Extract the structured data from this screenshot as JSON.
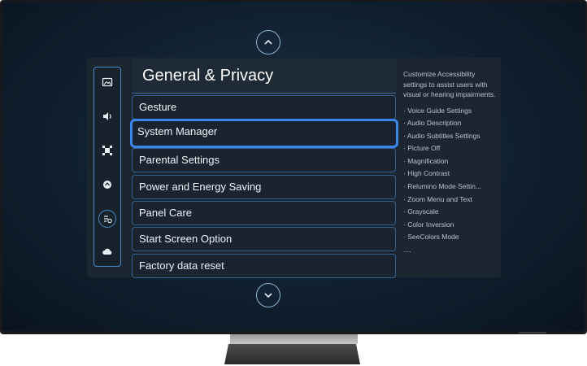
{
  "menu": {
    "title": "General & Privacy",
    "items": [
      {
        "label": "Gesture"
      },
      {
        "label": "System Manager"
      },
      {
        "label": "Parental Settings"
      },
      {
        "label": "Power and Energy Saving"
      },
      {
        "label": "Panel Care"
      },
      {
        "label": "Start Screen Option"
      },
      {
        "label": "Factory data reset"
      }
    ],
    "focused_item": "System Manager"
  },
  "sidebar": {
    "icons": [
      "picture-icon",
      "sound-icon",
      "connection-icon",
      "support-icon",
      "general-privacy-icon",
      "cloud-icon"
    ],
    "active": "general-privacy-icon"
  },
  "description": {
    "text": "Customize Accessibility settings to assist users with visual or hearing impairments.",
    "items": [
      "· Voice Guide Settings",
      "· Audio Description",
      "· Audio Subtitles Settings",
      "· Picture Off",
      "· Magnification",
      "· High Contrast",
      "· Relumino Mode Settin...",
      "· Zoom Menu and Text",
      "· Grayscale",
      "· Color Inversion",
      "· SeeColors Mode",
      "...."
    ]
  },
  "colors": {
    "accent": "#3b86e8",
    "item_border": "#35618f",
    "panel_bg": "#1c2631"
  }
}
